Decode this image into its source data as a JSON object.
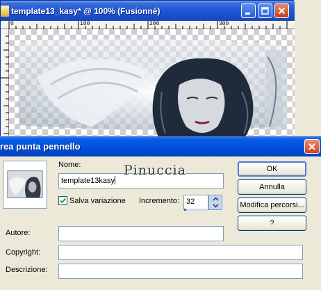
{
  "window": {
    "title": "template13_kasy* @ 100% (Fusionné)",
    "ruler_labels": [
      "0",
      "100",
      "200",
      "300"
    ]
  },
  "watermark": "Pinuccia",
  "dialog": {
    "title": "rea punta pennello",
    "name_label": "Nome:",
    "name_value": "template13kasy",
    "save_variation_label": "Salva variazione",
    "save_variation_checked": true,
    "increment_label": "Incremento:",
    "increment_value": "32",
    "increment_level": 0.1,
    "author_label": "Autore:",
    "author_value": "",
    "copyright_label": "Copyright:",
    "copyright_value": "",
    "description_label": "Descrizione:",
    "description_value": "",
    "buttons": {
      "ok": "OK",
      "cancel": "Annulla",
      "edit_paths": "Modifica percorsi...",
      "help": "?"
    }
  },
  "colors": {
    "titlebar": "#0054e3",
    "close_button": "#d0401c",
    "dialog_bg": "#ece9d8"
  }
}
